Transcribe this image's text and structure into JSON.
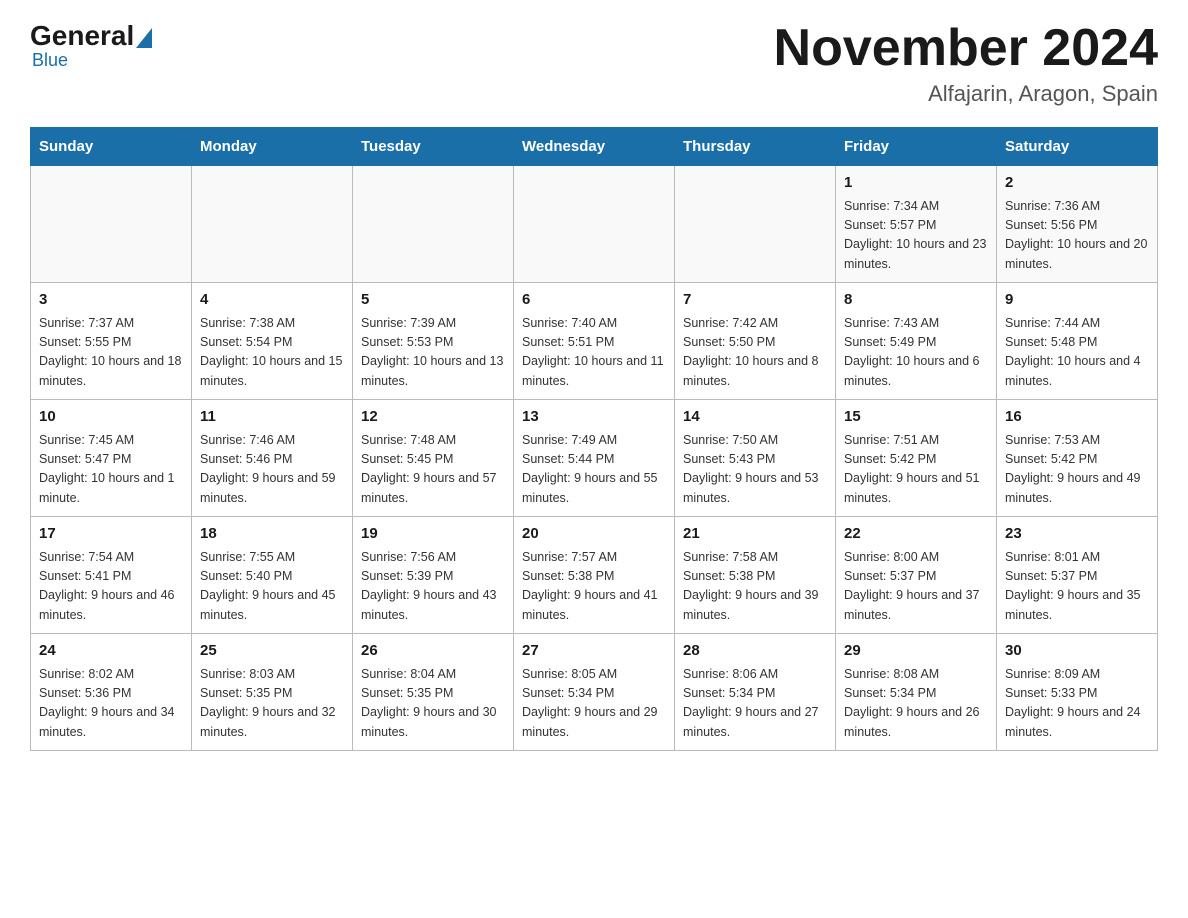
{
  "header": {
    "logo": {
      "general": "General",
      "blue": "Blue"
    },
    "title": "November 2024",
    "location": "Alfajarin, Aragon, Spain"
  },
  "days_of_week": [
    "Sunday",
    "Monday",
    "Tuesday",
    "Wednesday",
    "Thursday",
    "Friday",
    "Saturday"
  ],
  "weeks": [
    [
      {
        "day": "",
        "info": ""
      },
      {
        "day": "",
        "info": ""
      },
      {
        "day": "",
        "info": ""
      },
      {
        "day": "",
        "info": ""
      },
      {
        "day": "",
        "info": ""
      },
      {
        "day": "1",
        "info": "Sunrise: 7:34 AM\nSunset: 5:57 PM\nDaylight: 10 hours and 23 minutes."
      },
      {
        "day": "2",
        "info": "Sunrise: 7:36 AM\nSunset: 5:56 PM\nDaylight: 10 hours and 20 minutes."
      }
    ],
    [
      {
        "day": "3",
        "info": "Sunrise: 7:37 AM\nSunset: 5:55 PM\nDaylight: 10 hours and 18 minutes."
      },
      {
        "day": "4",
        "info": "Sunrise: 7:38 AM\nSunset: 5:54 PM\nDaylight: 10 hours and 15 minutes."
      },
      {
        "day": "5",
        "info": "Sunrise: 7:39 AM\nSunset: 5:53 PM\nDaylight: 10 hours and 13 minutes."
      },
      {
        "day": "6",
        "info": "Sunrise: 7:40 AM\nSunset: 5:51 PM\nDaylight: 10 hours and 11 minutes."
      },
      {
        "day": "7",
        "info": "Sunrise: 7:42 AM\nSunset: 5:50 PM\nDaylight: 10 hours and 8 minutes."
      },
      {
        "day": "8",
        "info": "Sunrise: 7:43 AM\nSunset: 5:49 PM\nDaylight: 10 hours and 6 minutes."
      },
      {
        "day": "9",
        "info": "Sunrise: 7:44 AM\nSunset: 5:48 PM\nDaylight: 10 hours and 4 minutes."
      }
    ],
    [
      {
        "day": "10",
        "info": "Sunrise: 7:45 AM\nSunset: 5:47 PM\nDaylight: 10 hours and 1 minute."
      },
      {
        "day": "11",
        "info": "Sunrise: 7:46 AM\nSunset: 5:46 PM\nDaylight: 9 hours and 59 minutes."
      },
      {
        "day": "12",
        "info": "Sunrise: 7:48 AM\nSunset: 5:45 PM\nDaylight: 9 hours and 57 minutes."
      },
      {
        "day": "13",
        "info": "Sunrise: 7:49 AM\nSunset: 5:44 PM\nDaylight: 9 hours and 55 minutes."
      },
      {
        "day": "14",
        "info": "Sunrise: 7:50 AM\nSunset: 5:43 PM\nDaylight: 9 hours and 53 minutes."
      },
      {
        "day": "15",
        "info": "Sunrise: 7:51 AM\nSunset: 5:42 PM\nDaylight: 9 hours and 51 minutes."
      },
      {
        "day": "16",
        "info": "Sunrise: 7:53 AM\nSunset: 5:42 PM\nDaylight: 9 hours and 49 minutes."
      }
    ],
    [
      {
        "day": "17",
        "info": "Sunrise: 7:54 AM\nSunset: 5:41 PM\nDaylight: 9 hours and 46 minutes."
      },
      {
        "day": "18",
        "info": "Sunrise: 7:55 AM\nSunset: 5:40 PM\nDaylight: 9 hours and 45 minutes."
      },
      {
        "day": "19",
        "info": "Sunrise: 7:56 AM\nSunset: 5:39 PM\nDaylight: 9 hours and 43 minutes."
      },
      {
        "day": "20",
        "info": "Sunrise: 7:57 AM\nSunset: 5:38 PM\nDaylight: 9 hours and 41 minutes."
      },
      {
        "day": "21",
        "info": "Sunrise: 7:58 AM\nSunset: 5:38 PM\nDaylight: 9 hours and 39 minutes."
      },
      {
        "day": "22",
        "info": "Sunrise: 8:00 AM\nSunset: 5:37 PM\nDaylight: 9 hours and 37 minutes."
      },
      {
        "day": "23",
        "info": "Sunrise: 8:01 AM\nSunset: 5:37 PM\nDaylight: 9 hours and 35 minutes."
      }
    ],
    [
      {
        "day": "24",
        "info": "Sunrise: 8:02 AM\nSunset: 5:36 PM\nDaylight: 9 hours and 34 minutes."
      },
      {
        "day": "25",
        "info": "Sunrise: 8:03 AM\nSunset: 5:35 PM\nDaylight: 9 hours and 32 minutes."
      },
      {
        "day": "26",
        "info": "Sunrise: 8:04 AM\nSunset: 5:35 PM\nDaylight: 9 hours and 30 minutes."
      },
      {
        "day": "27",
        "info": "Sunrise: 8:05 AM\nSunset: 5:34 PM\nDaylight: 9 hours and 29 minutes."
      },
      {
        "day": "28",
        "info": "Sunrise: 8:06 AM\nSunset: 5:34 PM\nDaylight: 9 hours and 27 minutes."
      },
      {
        "day": "29",
        "info": "Sunrise: 8:08 AM\nSunset: 5:34 PM\nDaylight: 9 hours and 26 minutes."
      },
      {
        "day": "30",
        "info": "Sunrise: 8:09 AM\nSunset: 5:33 PM\nDaylight: 9 hours and 24 minutes."
      }
    ]
  ]
}
